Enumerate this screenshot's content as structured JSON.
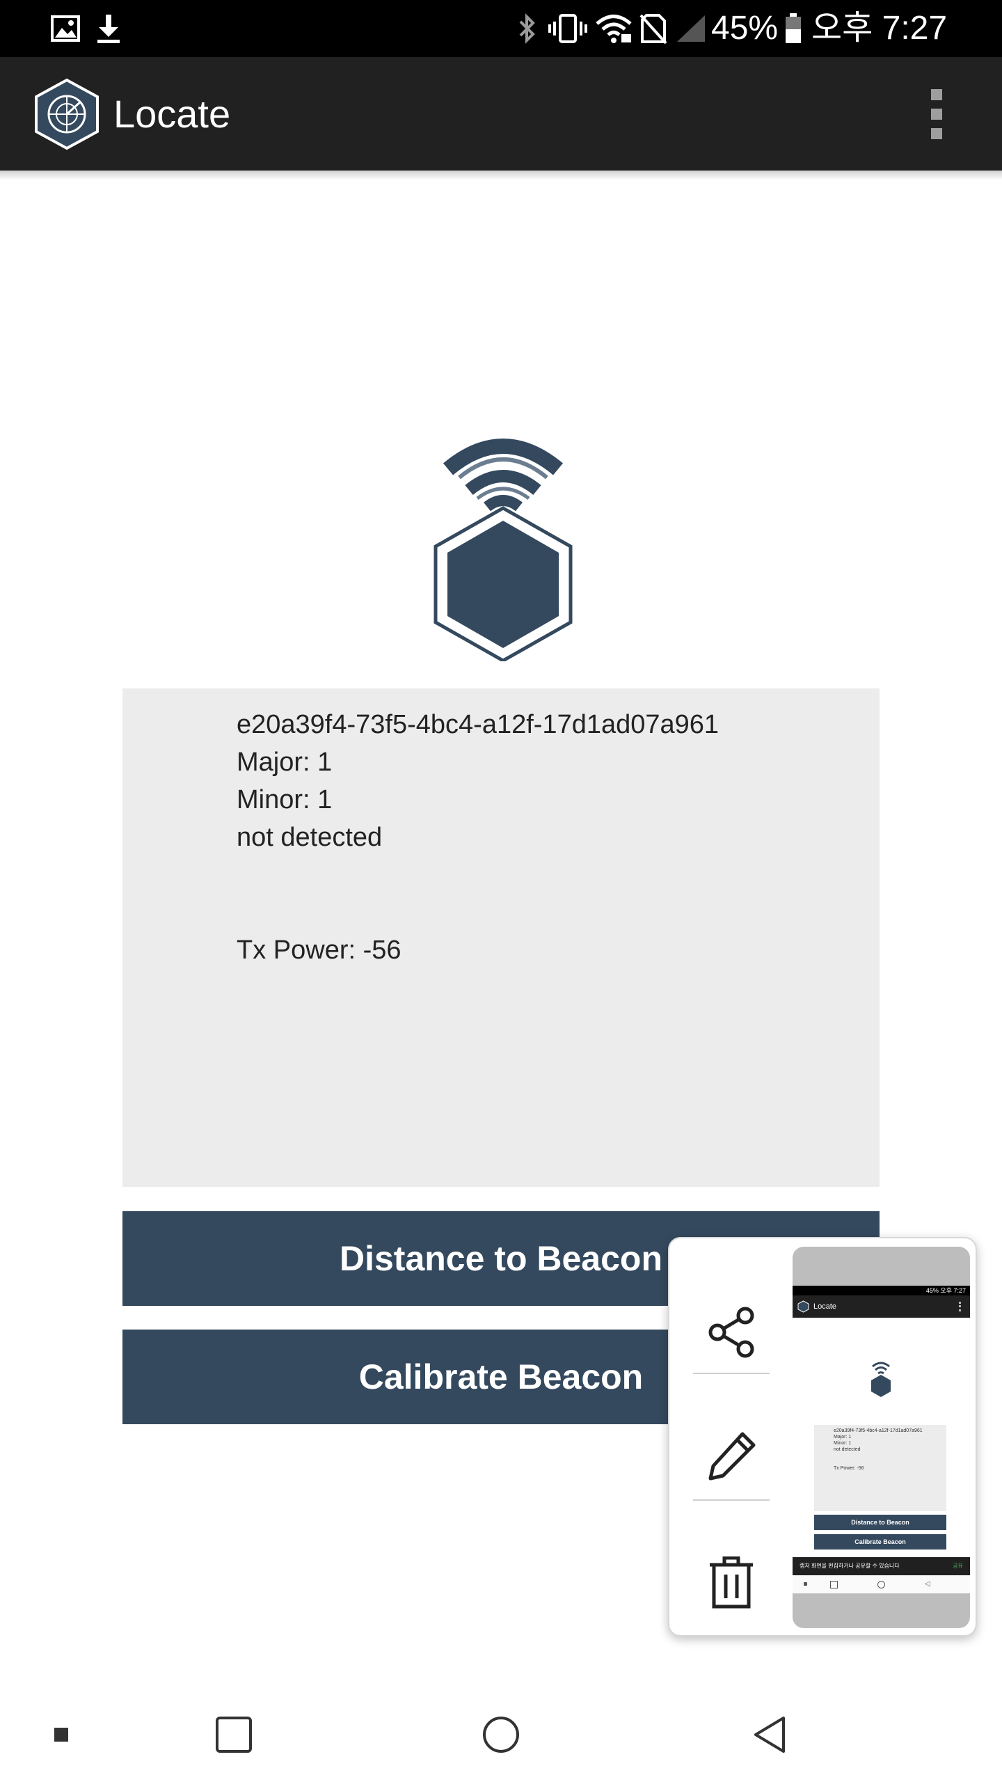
{
  "status_bar": {
    "battery": "45%",
    "time": "오후 7:27",
    "icons": [
      "gallery-icon",
      "download-icon",
      "bluetooth-icon",
      "vibrate-icon",
      "wifi-icon",
      "no-sim-icon",
      "signal-icon",
      "battery-icon"
    ]
  },
  "app_bar": {
    "title": "Locate",
    "logo_icon": "radar-hexagon-logo-icon",
    "menu_icon": "overflow-menu-icon"
  },
  "beacon": {
    "icon": "beacon-hexagon-wifi-icon",
    "uuid": "e20a39f4-73f5-4bc4-a12f-17d1ad07a961",
    "major": "Major: 1",
    "minor": "Minor: 1",
    "status": "not detected",
    "tx_power": "Tx Power: -56"
  },
  "buttons": {
    "distance": "Distance to Beacon",
    "calibrate": "Calibrate Beacon"
  },
  "screenshot_popup": {
    "actions": [
      "share-icon",
      "edit-icon",
      "delete-icon"
    ],
    "thumbnail": {
      "title": "Locate",
      "status_text": "45% 오후 7:27",
      "uuid": "e20a39f4-73f5-4bc4-a12f-17d1ad07a961",
      "major": "Major: 1",
      "minor": "Minor: 1",
      "status": "not detected",
      "tx_power": "Tx Power: -56",
      "distance": "Distance to Beacon",
      "calibrate": "Calibrate Beacon",
      "snackbar": "캡처 화면을 편집하거나 공유할 수 있습니다",
      "snackbar_action": "공유"
    }
  },
  "nav_bar": {
    "icons": [
      "dot-icon",
      "recents-icon",
      "home-icon",
      "back-icon"
    ]
  },
  "colors": {
    "app_bar": "#212121",
    "accent": "#34495e",
    "card": "#ececec"
  }
}
